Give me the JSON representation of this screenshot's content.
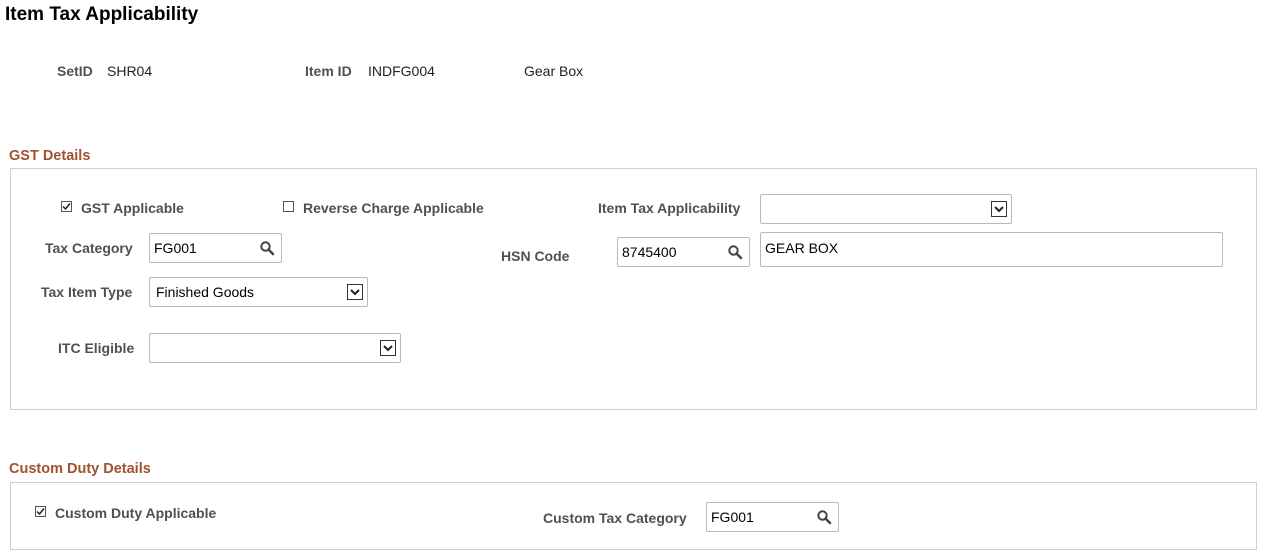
{
  "page_title": "Item Tax Applicability",
  "header": {
    "setid_label": "SetID",
    "setid_value": "SHR04",
    "itemid_label": "Item ID",
    "itemid_value": "INDFG004",
    "item_description": "Gear Box"
  },
  "gst": {
    "section_title": "GST Details",
    "gst_applicable_label": "GST Applicable",
    "gst_applicable_checked": true,
    "reverse_charge_label": "Reverse Charge Applicable",
    "reverse_charge_checked": false,
    "item_tax_applicability_label": "Item Tax Applicability",
    "item_tax_applicability_value": "",
    "tax_category_label": "Tax Category",
    "tax_category_value": "FG001",
    "hsn_code_label": "HSN Code",
    "hsn_code_value": "8745400",
    "hsn_description": "GEAR BOX",
    "tax_item_type_label": "Tax Item Type",
    "tax_item_type_value": "Finished Goods",
    "itc_eligible_label": "ITC Eligible",
    "itc_eligible_value": ""
  },
  "custom": {
    "section_title": "Custom Duty Details",
    "custom_duty_label": "Custom Duty Applicable",
    "custom_duty_checked": true,
    "custom_tax_category_label": "Custom Tax Category",
    "custom_tax_category_value": "FG001"
  },
  "icons": {
    "lookup": "magnifier-icon",
    "dropdown": "chevron-down-icon",
    "check": "checkmark-icon"
  },
  "colors": {
    "section_title": "#a0522d",
    "label": "#505050",
    "border": "#cfcfcf"
  }
}
